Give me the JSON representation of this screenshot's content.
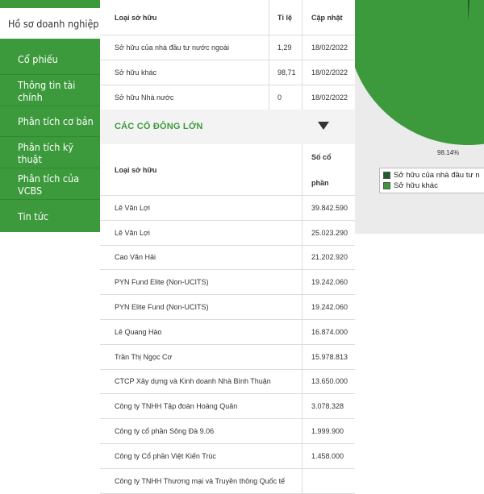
{
  "sidebar": {
    "items": [
      {
        "label": "Hồ sơ doanh nghiệp",
        "active": true
      },
      {
        "label": "Cổ phiếu"
      },
      {
        "label": "Thông tin tài chính"
      },
      {
        "label": "Phân tích cơ bản"
      },
      {
        "label": "Phân tích kỹ thuật"
      },
      {
        "label": "Phân tích của VCBS"
      },
      {
        "label": "Tin tức"
      }
    ]
  },
  "ownership_table": {
    "headers": {
      "type": "Loại sở hữu",
      "ratio": "Tỉ lệ",
      "updated": "Cập nhật"
    },
    "rows": [
      {
        "type": "Sở hữu của nhà đầu tư nước ngoài",
        "ratio": "1,29",
        "updated": "18/02/2022"
      },
      {
        "type": "Sở hữu khác",
        "ratio": "98,71",
        "updated": "18/02/2022"
      },
      {
        "type": "Sở hữu Nhà nước",
        "ratio": "0",
        "updated": "18/02/2022"
      }
    ]
  },
  "major_shareholders": {
    "title": "CÁC CỔ ĐÔNG LỚN",
    "headers": {
      "type": "Loại sở hữu",
      "shares_line1": "Số cổ",
      "shares_line2": "phần"
    },
    "rows": [
      {
        "name": "Lê Văn Lợi",
        "shares": "39.842.590"
      },
      {
        "name": "Lê Văn Lợi",
        "shares": "25.023.290"
      },
      {
        "name": "Cao Văn Hải",
        "shares": "21.202.920"
      },
      {
        "name": "PYN Fund Elite (Non-UCITS)",
        "shares": "19.242.060"
      },
      {
        "name": "PYN Elite Fund (Non-UCITS)",
        "shares": "19.242.060"
      },
      {
        "name": "Lê Quang Hào",
        "shares": "16.874.000"
      },
      {
        "name": "Trần Thị Ngọc Cơ",
        "shares": "15.978.813"
      },
      {
        "name": "CTCP Xây dựng và Kinh doanh Nhà Bình Thuận",
        "shares": "13.650.000"
      },
      {
        "name": "Công ty TNHH Tập đoàn Hoàng Quân",
        "shares": "3.078.328"
      },
      {
        "name": "Công ty cổ phần Sông Đà 9.06",
        "shares": "1.999.900"
      },
      {
        "name": "Công ty Cổ phần Việt Kiến Trúc",
        "shares": "1.458.000"
      },
      {
        "name": "Công ty TNHH Thương mại và Truyền thông Quốc tế",
        "shares": ""
      }
    ]
  },
  "pie": {
    "percent_label": "98.14%",
    "legend": [
      {
        "label": "Sở hữu của nhà đầu tư n",
        "color": "#1f5e2a"
      },
      {
        "label": "Sở hữu khác",
        "color": "#3c9a3c"
      }
    ]
  },
  "chart_data": {
    "type": "pie",
    "slices": [
      {
        "label": "Sở hữu của nhà đầu tư n",
        "value": 1.29
      },
      {
        "label": "Sở hữu khác",
        "value": 98.71
      }
    ]
  },
  "colors": {
    "accent": "#3c9a3c",
    "dark_green": "#1f5e2a"
  }
}
